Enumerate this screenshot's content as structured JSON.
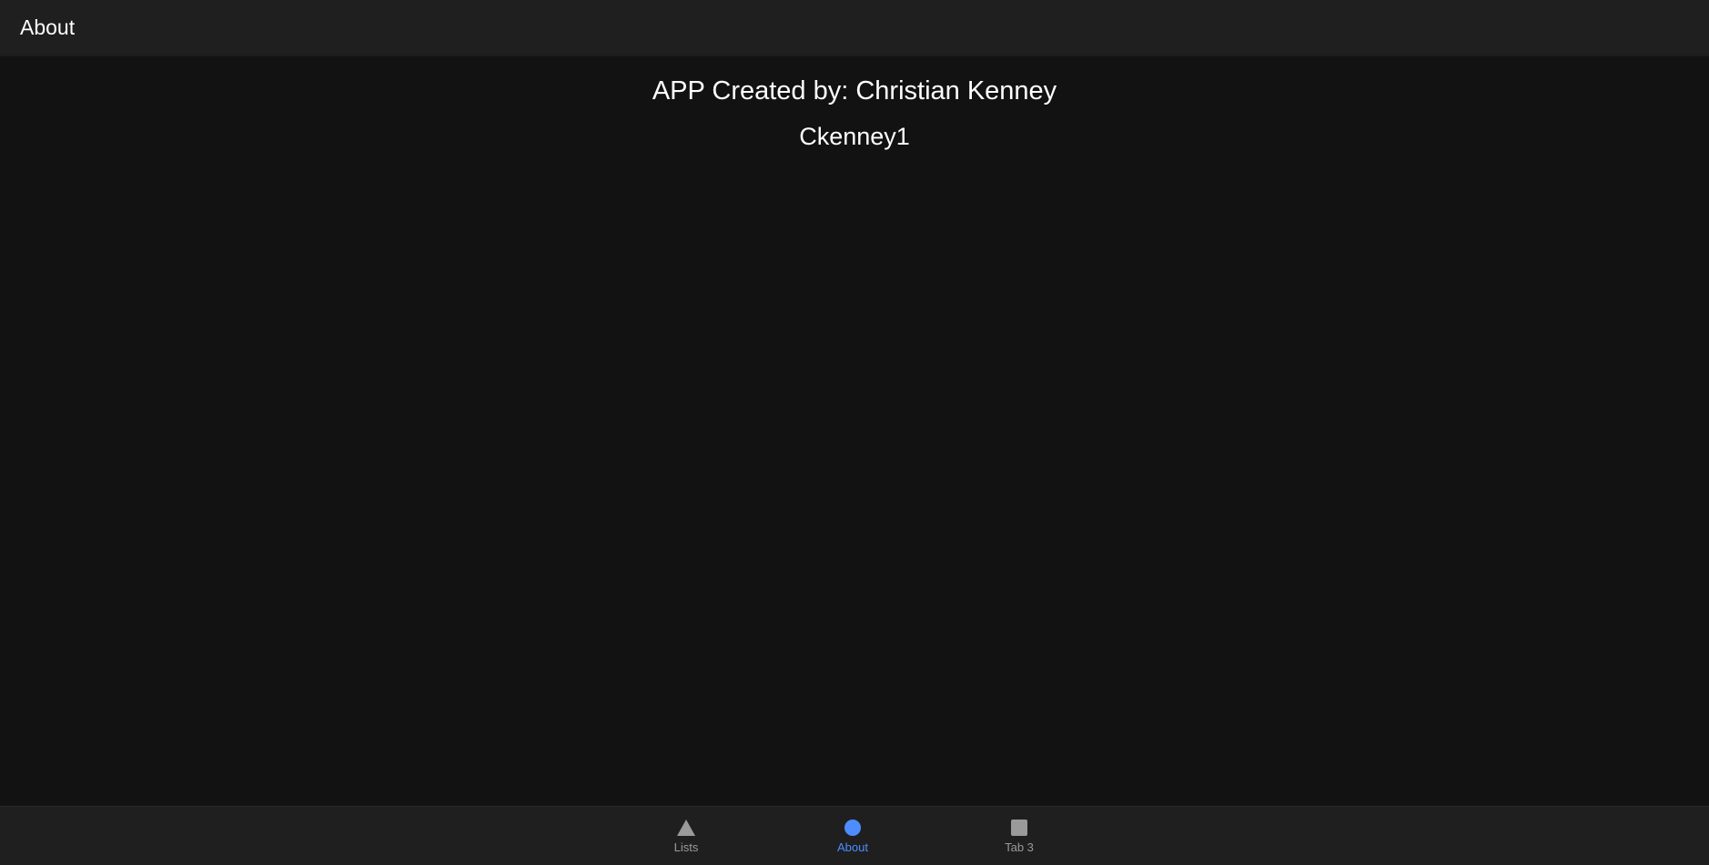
{
  "header": {
    "title": "About"
  },
  "content": {
    "line1": "APP Created by: Christian Kenney",
    "line2": "Ckenney1"
  },
  "tabs": [
    {
      "label": "Lists",
      "icon": "triangle-icon",
      "selected": false
    },
    {
      "label": "About",
      "icon": "circle-icon",
      "selected": true
    },
    {
      "label": "Tab 3",
      "icon": "square-icon",
      "selected": false
    }
  ],
  "colors": {
    "background": "#121212",
    "toolbar": "#1f1f1f",
    "accent": "#4d8dff",
    "inactive": "#9a9a9a"
  }
}
